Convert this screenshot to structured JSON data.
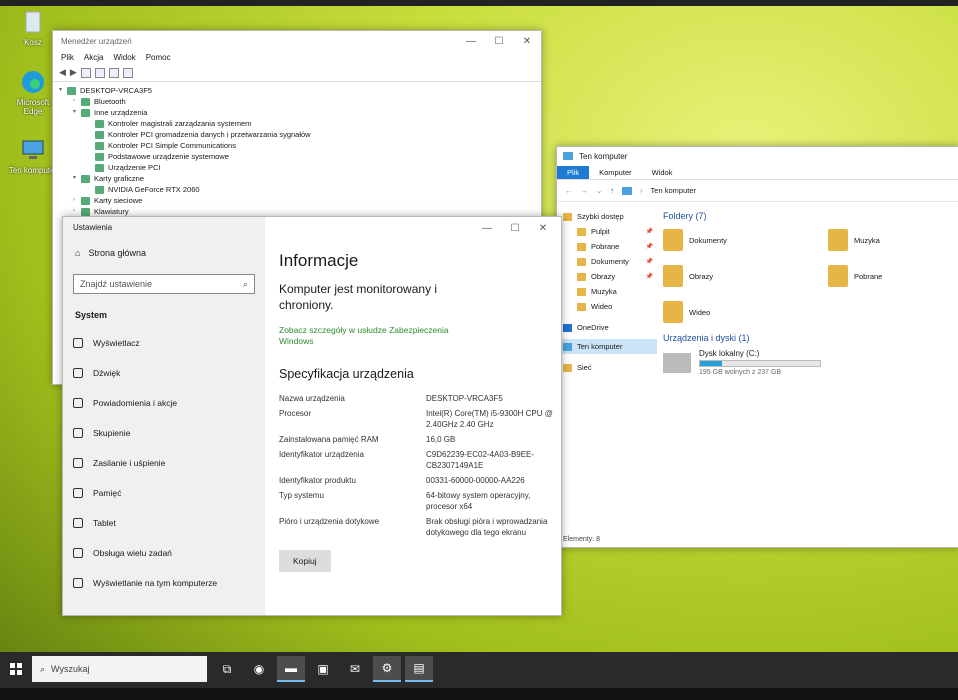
{
  "desktop": {
    "icons": [
      {
        "label": "Kosz",
        "icon": "recycle-bin-icon"
      },
      {
        "label": "Microsoft Edge",
        "icon": "edge-icon"
      },
      {
        "label": "Ten komputer",
        "icon": "computer-icon"
      }
    ]
  },
  "device_manager": {
    "title": "Menedżer urządzeń",
    "menu": [
      "Plik",
      "Akcja",
      "Widok",
      "Pomoc"
    ],
    "tree": [
      {
        "label": "DESKTOP-VRCA3F5",
        "level": 0,
        "toggle": "▾"
      },
      {
        "label": "Bluetooth",
        "level": 1,
        "toggle": "›"
      },
      {
        "label": "Inne urządzenia",
        "level": 1,
        "toggle": "▾"
      },
      {
        "label": "Kontroler magistrali zarządzania systemem",
        "level": 2,
        "toggle": ""
      },
      {
        "label": "Kontroler PCI gromadzenia danych i przetwarzania sygnałów",
        "level": 2,
        "toggle": ""
      },
      {
        "label": "Kontroler PCI Simple Communications",
        "level": 2,
        "toggle": ""
      },
      {
        "label": "Podstawowe urządzenie systemowe",
        "level": 2,
        "toggle": ""
      },
      {
        "label": "Urządzenie PCI",
        "level": 2,
        "toggle": ""
      },
      {
        "label": "Karty graficzne",
        "level": 1,
        "toggle": "▾"
      },
      {
        "label": "NVIDIA GeForce RTX 2060",
        "level": 2,
        "toggle": ""
      },
      {
        "label": "Karty sieciowe",
        "level": 1,
        "toggle": "›"
      },
      {
        "label": "Klawiatury",
        "level": 1,
        "toggle": "›"
      }
    ]
  },
  "settings": {
    "title": "Ustawienia",
    "home": "Strona główna",
    "search_placeholder": "Znajdź ustawienie",
    "section": "System",
    "nav": [
      "Wyświetlacz",
      "Dźwięk",
      "Powiadomienia i akcje",
      "Skupienie",
      "Zasilanie i uśpienie",
      "Pamięć",
      "Tablet",
      "Obsługa wielu zadań",
      "Wyświetlanie na tym komputerze"
    ],
    "heading": "Informacje",
    "monitored": "Komputer jest monitorowany i chroniony.",
    "security_link": "Zobacz szczegóły w usłudze Zabezpieczenia Windows",
    "spec_heading": "Specyfikacja urządzenia",
    "specs": [
      {
        "key": "Nazwa urządzenia",
        "value": "DESKTOP-VRCA3F5"
      },
      {
        "key": "Procesor",
        "value": "Intel(R) Core(TM) i5-9300H CPU @ 2.40GHz   2.40 GHz"
      },
      {
        "key": "Zainstalowana pamięć RAM",
        "value": "16,0 GB"
      },
      {
        "key": "Identyfikator urządzenia",
        "value": "C9D62239-EC02-4A03-B9EE-CB2307149A1E"
      },
      {
        "key": "Identyfikator produktu",
        "value": "00331-60000-00000-AA226"
      },
      {
        "key": "Typ systemu",
        "value": "64-bitowy system operacyjny, procesor x64"
      },
      {
        "key": "Pióro i urządzenia dotykowe",
        "value": "Brak obsługi pióra i wprowadzania dotykowego dla tego ekranu"
      }
    ],
    "copy_button": "Kopiuj"
  },
  "explorer": {
    "title": "Ten komputer",
    "ribbon": [
      "Plik",
      "Komputer",
      "Widok"
    ],
    "address": "Ten komputer",
    "nav": [
      {
        "label": "Szybki dostęp",
        "pinned": false,
        "selected": false
      },
      {
        "label": "Pulpit",
        "pinned": true,
        "selected": false
      },
      {
        "label": "Pobrane",
        "pinned": true,
        "selected": false
      },
      {
        "label": "Dokumenty",
        "pinned": true,
        "selected": false
      },
      {
        "label": "Obrazy",
        "pinned": true,
        "selected": false
      },
      {
        "label": "Muzyka",
        "pinned": false,
        "selected": false
      },
      {
        "label": "Wideo",
        "pinned": false,
        "selected": false
      },
      {
        "label": "OneDrive",
        "pinned": false,
        "selected": false
      },
      {
        "label": "Ten komputer",
        "pinned": false,
        "selected": true
      },
      {
        "label": "Sieć",
        "pinned": false,
        "selected": false
      }
    ],
    "folders_group": "Foldery (7)",
    "folders": [
      "Dokumenty",
      "Muzyka",
      "Obrazy",
      "Pobrane",
      "Wideo"
    ],
    "drives_group": "Urządzenia i dyski (1)",
    "drive": {
      "name": "Dysk lokalny (C:)",
      "free": "195 GB wolnych z 237 GB",
      "used_fraction": 0.18
    },
    "status": "Elementy: 8"
  },
  "taskbar": {
    "search_placeholder": "Wyszukaj",
    "apps": [
      "task-view-icon",
      "edge-icon",
      "file-explorer-icon",
      "store-icon",
      "mail-icon",
      "settings-icon",
      "device-manager-icon"
    ]
  },
  "colors": {
    "accent": "#1e7ad3",
    "link": "#2e8b2e",
    "drive_fill": "#26a0da"
  }
}
